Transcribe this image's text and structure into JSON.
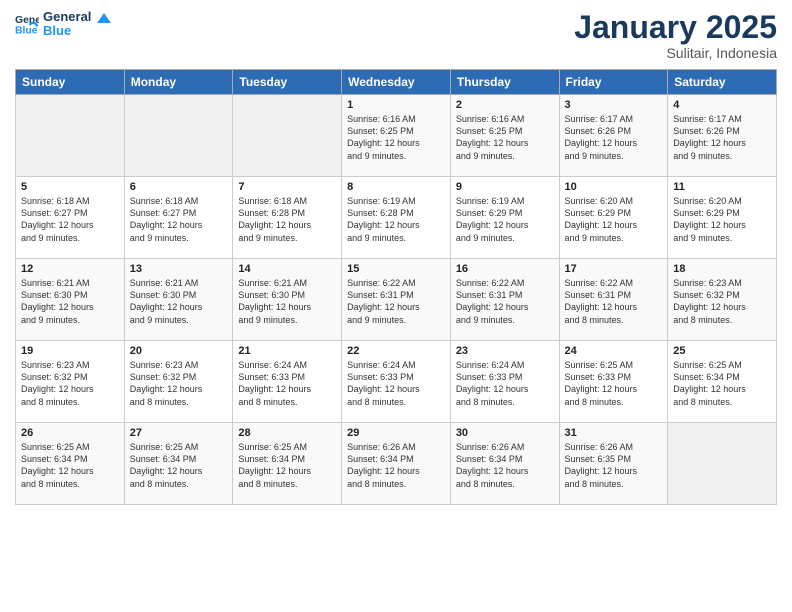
{
  "logo": {
    "general": "General",
    "blue": "Blue"
  },
  "header": {
    "title": "January 2025",
    "location": "Sulitair, Indonesia"
  },
  "columns": [
    "Sunday",
    "Monday",
    "Tuesday",
    "Wednesday",
    "Thursday",
    "Friday",
    "Saturday"
  ],
  "weeks": [
    [
      {
        "day": "",
        "info": ""
      },
      {
        "day": "",
        "info": ""
      },
      {
        "day": "",
        "info": ""
      },
      {
        "day": "1",
        "info": "Sunrise: 6:16 AM\nSunset: 6:25 PM\nDaylight: 12 hours\nand 9 minutes."
      },
      {
        "day": "2",
        "info": "Sunrise: 6:16 AM\nSunset: 6:25 PM\nDaylight: 12 hours\nand 9 minutes."
      },
      {
        "day": "3",
        "info": "Sunrise: 6:17 AM\nSunset: 6:26 PM\nDaylight: 12 hours\nand 9 minutes."
      },
      {
        "day": "4",
        "info": "Sunrise: 6:17 AM\nSunset: 6:26 PM\nDaylight: 12 hours\nand 9 minutes."
      }
    ],
    [
      {
        "day": "5",
        "info": "Sunrise: 6:18 AM\nSunset: 6:27 PM\nDaylight: 12 hours\nand 9 minutes."
      },
      {
        "day": "6",
        "info": "Sunrise: 6:18 AM\nSunset: 6:27 PM\nDaylight: 12 hours\nand 9 minutes."
      },
      {
        "day": "7",
        "info": "Sunrise: 6:18 AM\nSunset: 6:28 PM\nDaylight: 12 hours\nand 9 minutes."
      },
      {
        "day": "8",
        "info": "Sunrise: 6:19 AM\nSunset: 6:28 PM\nDaylight: 12 hours\nand 9 minutes."
      },
      {
        "day": "9",
        "info": "Sunrise: 6:19 AM\nSunset: 6:29 PM\nDaylight: 12 hours\nand 9 minutes."
      },
      {
        "day": "10",
        "info": "Sunrise: 6:20 AM\nSunset: 6:29 PM\nDaylight: 12 hours\nand 9 minutes."
      },
      {
        "day": "11",
        "info": "Sunrise: 6:20 AM\nSunset: 6:29 PM\nDaylight: 12 hours\nand 9 minutes."
      }
    ],
    [
      {
        "day": "12",
        "info": "Sunrise: 6:21 AM\nSunset: 6:30 PM\nDaylight: 12 hours\nand 9 minutes."
      },
      {
        "day": "13",
        "info": "Sunrise: 6:21 AM\nSunset: 6:30 PM\nDaylight: 12 hours\nand 9 minutes."
      },
      {
        "day": "14",
        "info": "Sunrise: 6:21 AM\nSunset: 6:30 PM\nDaylight: 12 hours\nand 9 minutes."
      },
      {
        "day": "15",
        "info": "Sunrise: 6:22 AM\nSunset: 6:31 PM\nDaylight: 12 hours\nand 9 minutes."
      },
      {
        "day": "16",
        "info": "Sunrise: 6:22 AM\nSunset: 6:31 PM\nDaylight: 12 hours\nand 9 minutes."
      },
      {
        "day": "17",
        "info": "Sunrise: 6:22 AM\nSunset: 6:31 PM\nDaylight: 12 hours\nand 8 minutes."
      },
      {
        "day": "18",
        "info": "Sunrise: 6:23 AM\nSunset: 6:32 PM\nDaylight: 12 hours\nand 8 minutes."
      }
    ],
    [
      {
        "day": "19",
        "info": "Sunrise: 6:23 AM\nSunset: 6:32 PM\nDaylight: 12 hours\nand 8 minutes."
      },
      {
        "day": "20",
        "info": "Sunrise: 6:23 AM\nSunset: 6:32 PM\nDaylight: 12 hours\nand 8 minutes."
      },
      {
        "day": "21",
        "info": "Sunrise: 6:24 AM\nSunset: 6:33 PM\nDaylight: 12 hours\nand 8 minutes."
      },
      {
        "day": "22",
        "info": "Sunrise: 6:24 AM\nSunset: 6:33 PM\nDaylight: 12 hours\nand 8 minutes."
      },
      {
        "day": "23",
        "info": "Sunrise: 6:24 AM\nSunset: 6:33 PM\nDaylight: 12 hours\nand 8 minutes."
      },
      {
        "day": "24",
        "info": "Sunrise: 6:25 AM\nSunset: 6:33 PM\nDaylight: 12 hours\nand 8 minutes."
      },
      {
        "day": "25",
        "info": "Sunrise: 6:25 AM\nSunset: 6:34 PM\nDaylight: 12 hours\nand 8 minutes."
      }
    ],
    [
      {
        "day": "26",
        "info": "Sunrise: 6:25 AM\nSunset: 6:34 PM\nDaylight: 12 hours\nand 8 minutes."
      },
      {
        "day": "27",
        "info": "Sunrise: 6:25 AM\nSunset: 6:34 PM\nDaylight: 12 hours\nand 8 minutes."
      },
      {
        "day": "28",
        "info": "Sunrise: 6:25 AM\nSunset: 6:34 PM\nDaylight: 12 hours\nand 8 minutes."
      },
      {
        "day": "29",
        "info": "Sunrise: 6:26 AM\nSunset: 6:34 PM\nDaylight: 12 hours\nand 8 minutes."
      },
      {
        "day": "30",
        "info": "Sunrise: 6:26 AM\nSunset: 6:34 PM\nDaylight: 12 hours\nand 8 minutes."
      },
      {
        "day": "31",
        "info": "Sunrise: 6:26 AM\nSunset: 6:35 PM\nDaylight: 12 hours\nand 8 minutes."
      },
      {
        "day": "",
        "info": ""
      }
    ]
  ]
}
